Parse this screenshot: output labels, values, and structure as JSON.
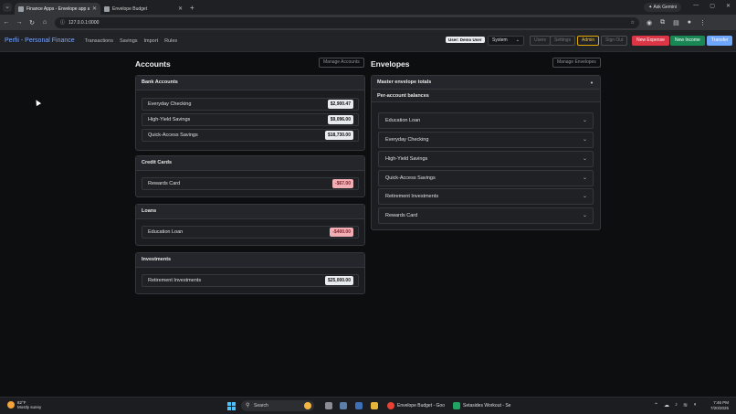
{
  "browser": {
    "tabs": [
      {
        "title": "Finance Apps - Envelope app a",
        "active": true
      },
      {
        "title": "Envelope Budget",
        "active": false
      }
    ],
    "ask_gemini": "Ask Gemini",
    "url": "127.0.0.1:0000"
  },
  "app": {
    "brand": "Perfii - Personal Finance",
    "nav": [
      "Transactions",
      "Savings",
      "Import",
      "Rules"
    ],
    "user_badge": "User: Demo User",
    "theme_select": "System",
    "buttons": {
      "users": "Users",
      "settings": "Settings",
      "admin": "Admin",
      "sign_out": "Sign Out",
      "new_expense": "New Expense",
      "new_income": "New Income",
      "transfer": "Transfer"
    }
  },
  "accounts": {
    "title": "Accounts",
    "manage_label": "Manage Accounts",
    "groups": [
      {
        "name": "Bank Accounts",
        "items": [
          {
            "name": "Everyday Checking",
            "amount": "$2,900.47",
            "negative": false
          },
          {
            "name": "High-Yield Savings",
            "amount": "$9,096.00",
            "negative": false
          },
          {
            "name": "Quick-Access Savings",
            "amount": "$18,730.00",
            "negative": false
          }
        ]
      },
      {
        "name": "Credit Cards",
        "items": [
          {
            "name": "Rewards Card",
            "amount": "-$67.00",
            "negative": true
          }
        ]
      },
      {
        "name": "Loans",
        "items": [
          {
            "name": "Education Loan",
            "amount": "-$400.00",
            "negative": true
          }
        ]
      },
      {
        "name": "Investments",
        "items": [
          {
            "name": "Retirement Investments",
            "amount": "$25,000.00",
            "negative": false
          }
        ]
      }
    ]
  },
  "envelopes": {
    "title": "Envelopes",
    "manage_label": "Manage Envelopes",
    "master_label": "Master envelope totals",
    "per_account_label": "Per-account balances",
    "accounts": [
      "Education Loan",
      "Everyday Checking",
      "High-Yield Savings",
      "Quick-Access Savings",
      "Retirement Investments",
      "Rewards Card"
    ]
  },
  "taskbar": {
    "weather_temp": "82°F",
    "weather_desc": "Mostly sunny",
    "search_placeholder": "Search",
    "apps": [
      "Envelope Budget - Goo",
      "Setasides Workout - Se"
    ],
    "time": "7:46 PM",
    "date": "7/20/2025"
  }
}
